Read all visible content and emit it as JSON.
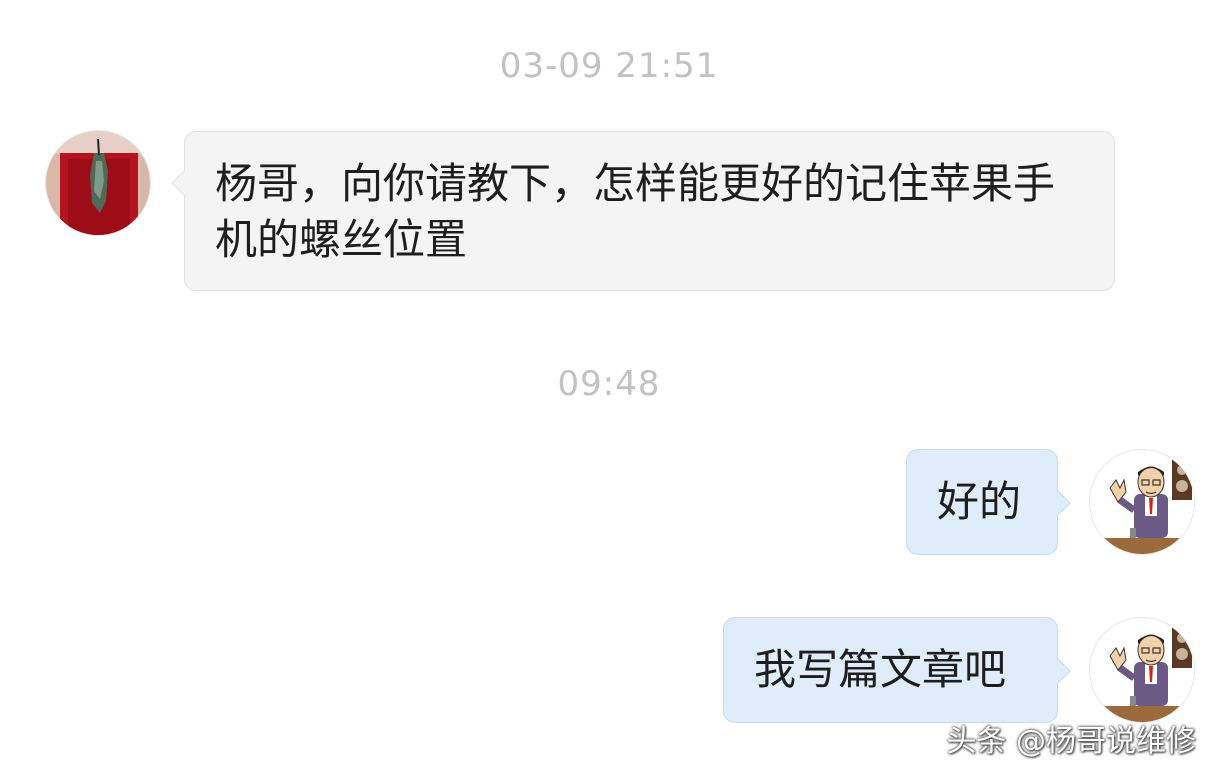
{
  "messages": [
    {
      "timestamp": "03-09 21:51"
    },
    {
      "from": "contact",
      "text": "杨哥，向你请教下，怎样能更好的记住苹果手机的螺丝位置"
    },
    {
      "timestamp": "09:48"
    },
    {
      "from": "me",
      "text": "好的"
    },
    {
      "from": "me",
      "text": "我写篇文章吧"
    }
  ],
  "watermark": "头条 @杨哥说维修",
  "colors": {
    "incoming_bubble": "#f4f4f4",
    "outgoing_bubble": "#dfedfb",
    "timestamp": "#c2c2c2"
  },
  "icons": {
    "contact_avatar": "jade-pendant-photo-avatar",
    "my_avatar": "cartoon-man-waving-avatar"
  }
}
